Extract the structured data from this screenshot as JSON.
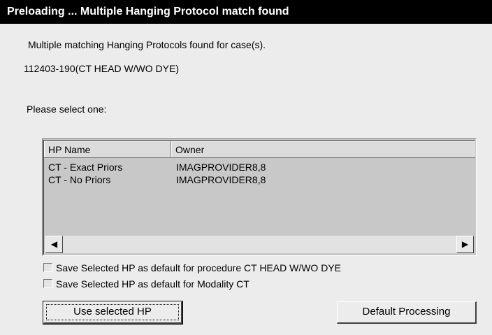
{
  "window": {
    "title": "Preloading ... Multiple Hanging Protocol match found"
  },
  "message": {
    "line1": "Multiple matching Hanging Protocols found for case(s).",
    "case_id": "112403-190(CT HEAD W/WO DYE)",
    "prompt": "Please select one:"
  },
  "list": {
    "columns": [
      "HP Name",
      "Owner"
    ],
    "rows": [
      {
        "name": "CT - Exact Priors",
        "owner": "IMAGPROVIDER8,8"
      },
      {
        "name": "CT - No Priors",
        "owner": "IMAGPROVIDER8,8"
      }
    ],
    "scroll_left_icon": "◀",
    "scroll_right_icon": "▶"
  },
  "options": {
    "save_procedure": "Save Selected HP as default for procedure CT HEAD W/WO DYE",
    "save_modality": "Save Selected HP as default for Modality  CT"
  },
  "buttons": {
    "use_selected": "Use selected HP",
    "default_processing": "Default Processing"
  }
}
